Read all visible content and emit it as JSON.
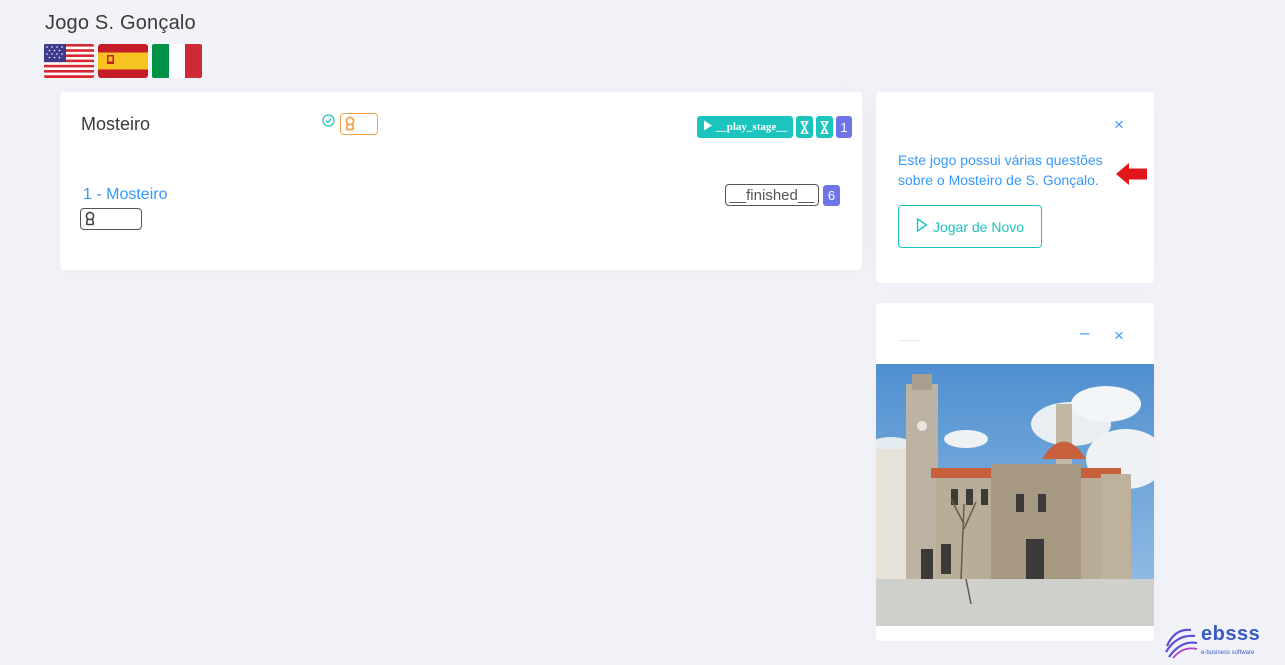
{
  "header": {
    "title": "Jogo S. Gonçalo",
    "flags": [
      "us-flag",
      "spain-flag",
      "italy-flag"
    ]
  },
  "stage": {
    "title": "Mosteiro",
    "play_label": "__play_stage__",
    "count": "1"
  },
  "level": {
    "link": "1 - Mosteiro",
    "status": "__finished__",
    "count": "6"
  },
  "info": {
    "text": "Este jogo possui várias questões sobre o Mosteiro de S. Gonçalo.",
    "replay_label": "Jogar de Novo"
  },
  "icons": {
    "close": "×",
    "minimize": "–"
  },
  "brand": {
    "name": "ebsss",
    "tagline": "e-business software"
  },
  "colors": {
    "accent": "#3699ff",
    "success": "#1bc5bd",
    "primary": "#6f74e8",
    "warning": "#f6a04d",
    "arrow": "#e0161b"
  }
}
